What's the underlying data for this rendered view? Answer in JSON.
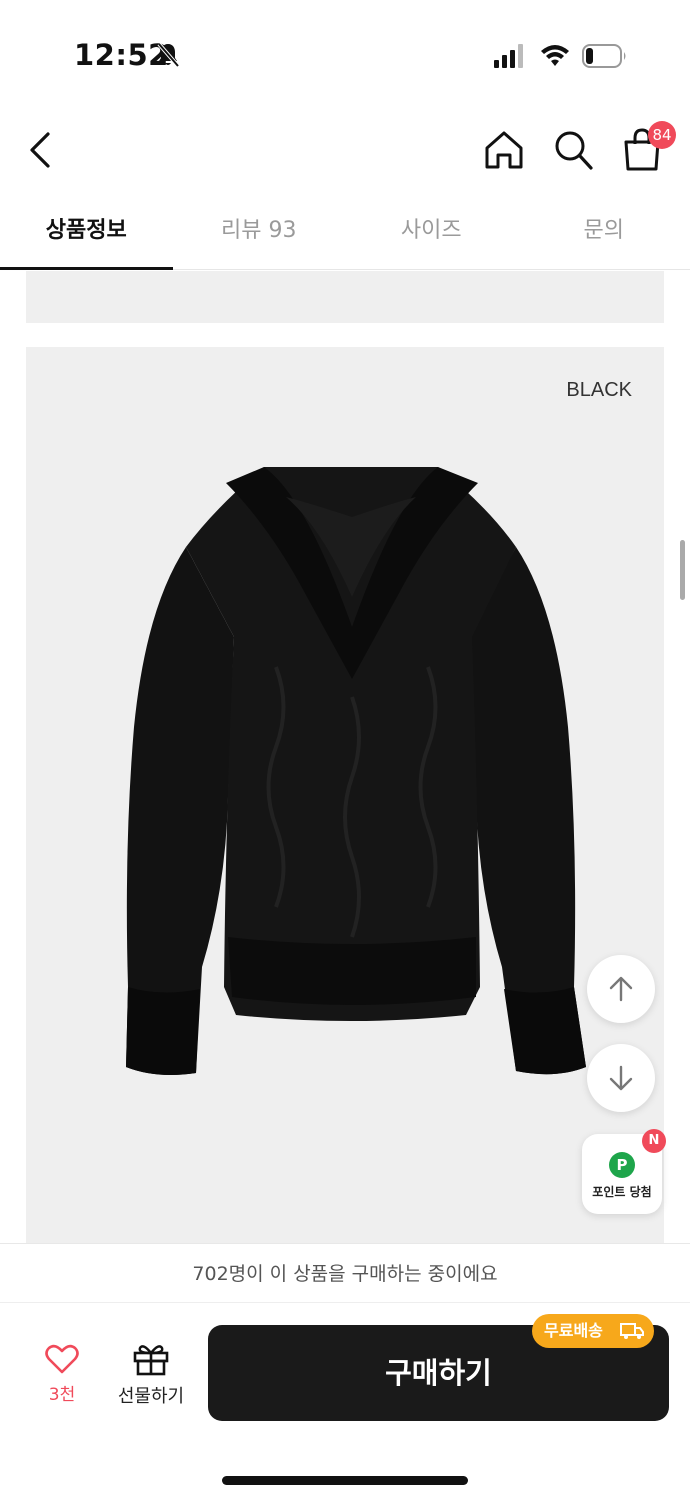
{
  "status_bar": {
    "time": "12:52"
  },
  "header": {
    "cart_count": "84"
  },
  "tabs": [
    {
      "label": "상품정보",
      "active": true
    },
    {
      "label": "리뷰 93",
      "active": false
    },
    {
      "label": "사이즈",
      "active": false
    },
    {
      "label": "문의",
      "active": false
    }
  ],
  "product": {
    "color_label": "BLACK"
  },
  "floating": {
    "point_icon_letter": "P",
    "point_label": "포인트 당첨",
    "new_badge": "N"
  },
  "buying_notice": "702명이 이 상품을 구매하는 중이에요",
  "bottom": {
    "like_count": "3천",
    "gift_label": "선물하기",
    "buy_label": "구매하기",
    "free_shipping_label": "무료배송"
  },
  "colors": {
    "accent_red": "#f04a5a",
    "buy_button": "#1a1a1a",
    "free_ship": "#f7a81b",
    "point_green": "#1ea54b"
  }
}
